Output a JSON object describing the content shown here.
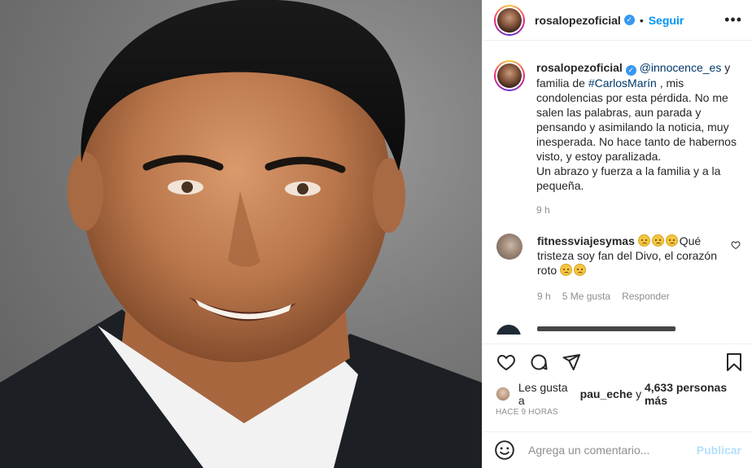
{
  "post": {
    "username": "rosalopezoficial",
    "follow_label": "Seguir",
    "more_icon": "more-horizontal-icon"
  },
  "caption": {
    "username": "rosalopezoficial",
    "mention": "@innocence_es",
    "text_1": " y familia de ",
    "hashtag": "#CarlosMarín",
    "text_2": " , mis condolencias por esta pérdida. No me salen las palabras, aun parada y pensando y asimilando la noticia, muy inesperada. No hace tanto de habernos visto, y estoy paralizada.",
    "text_3": "Un abrazo y fuerza a la familia y a la pequeña.",
    "time": "9 h"
  },
  "comment": {
    "username": "fitnessviajesymas",
    "text_1": "Qué tristeza soy fan del Divo, el corazón roto",
    "time": "9 h",
    "likes": "5 Me gusta",
    "reply_label": "Responder"
  },
  "likes": {
    "prefix": "Les gusta a",
    "user": "pau_eche",
    "connector": "y",
    "count": "4,633 personas más"
  },
  "ago": "HACE 9 HORAS",
  "composer": {
    "placeholder": "Agrega un comentario...",
    "publish_label": "Publicar"
  },
  "colors": {
    "link": "#0095f6",
    "publish_disabled": "#b2dffc",
    "verified": "#3897f0"
  }
}
